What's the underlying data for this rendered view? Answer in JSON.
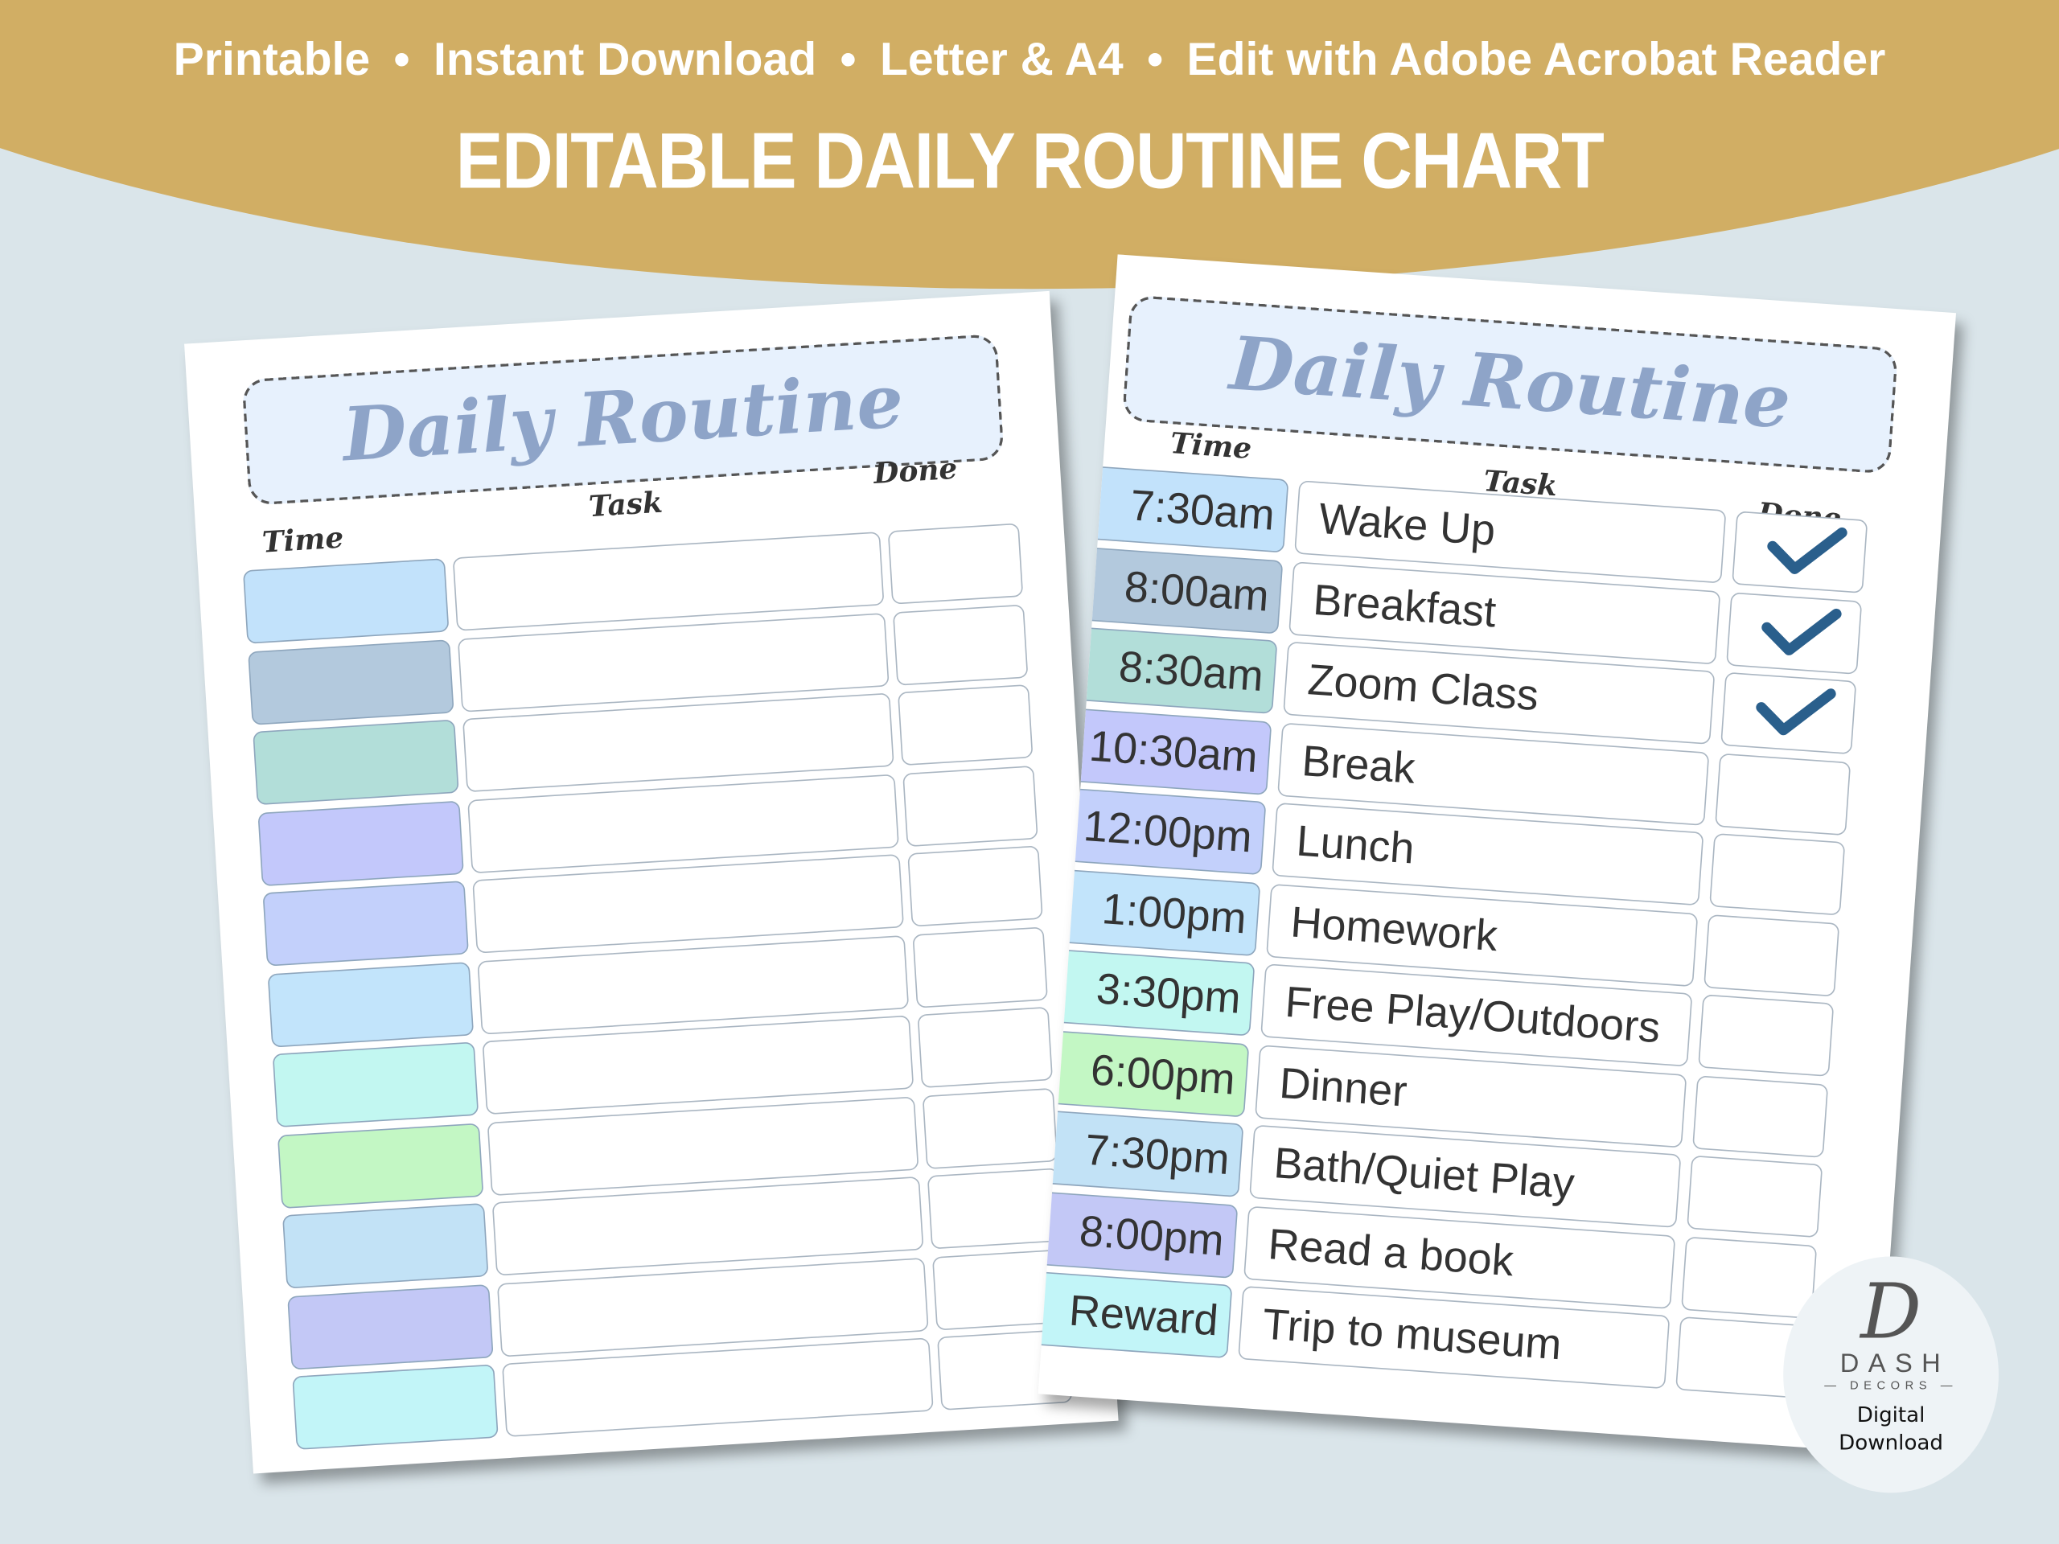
{
  "banner": {
    "features": [
      "Printable",
      "Instant Download",
      "Letter & A4",
      "Edit with Adobe Acrobat Reader"
    ],
    "separator": "•",
    "headline": "EDITABLE DAILY ROUTINE CHART"
  },
  "colors": {
    "banner": "#d1ae64",
    "background": "#dae5ea",
    "title": "#8ea4c8",
    "check": "#2a5f8c"
  },
  "left_page": {
    "title": "Daily Routine",
    "col_time": "Time",
    "col_task": "Task",
    "col_done": "Done",
    "row_colors": [
      "#c2e2fb",
      "#b3c9dd",
      "#b2ded9",
      "#c3c8fb",
      "#c3d0fb",
      "#c2e4fb",
      "#c2f7f1",
      "#c3f7c4",
      "#c2e2f6",
      "#c3c8f6",
      "#c2f5f8"
    ]
  },
  "right_page": {
    "title": "Daily Routine",
    "col_time": "Time",
    "col_task": "Task",
    "col_done": "Done",
    "rows": [
      {
        "time": "7:30am",
        "task": "Wake Up",
        "done": true,
        "color": "#c2e2fb"
      },
      {
        "time": "8:00am",
        "task": "Breakfast",
        "done": true,
        "color": "#b3c9dd"
      },
      {
        "time": "8:30am",
        "task": "Zoom Class",
        "done": true,
        "color": "#b2ded9"
      },
      {
        "time": "10:30am",
        "task": "Break",
        "done": false,
        "color": "#c3c8fb"
      },
      {
        "time": "12:00pm",
        "task": "Lunch",
        "done": false,
        "color": "#c3d0fb"
      },
      {
        "time": "1:00pm",
        "task": "Homework",
        "done": false,
        "color": "#c2e4fb"
      },
      {
        "time": "3:30pm",
        "task": "Free Play/Outdoors",
        "done": false,
        "color": "#c2f7f1"
      },
      {
        "time": "6:00pm",
        "task": "Dinner",
        "done": false,
        "color": "#c3f7c4"
      },
      {
        "time": "7:30pm",
        "task": "Bath/Quiet Play",
        "done": false,
        "color": "#c2e2f6"
      },
      {
        "time": "8:00pm",
        "task": "Read a book",
        "done": false,
        "color": "#c3c8f6"
      },
      {
        "time": "Reward",
        "task": "Trip to museum",
        "done": false,
        "color": "#c2f5f8"
      }
    ]
  },
  "logo": {
    "mark": "D",
    "brand": "DASH",
    "sub": "— DECORS —",
    "badge_line1": "Digital",
    "badge_line2": "Download"
  }
}
